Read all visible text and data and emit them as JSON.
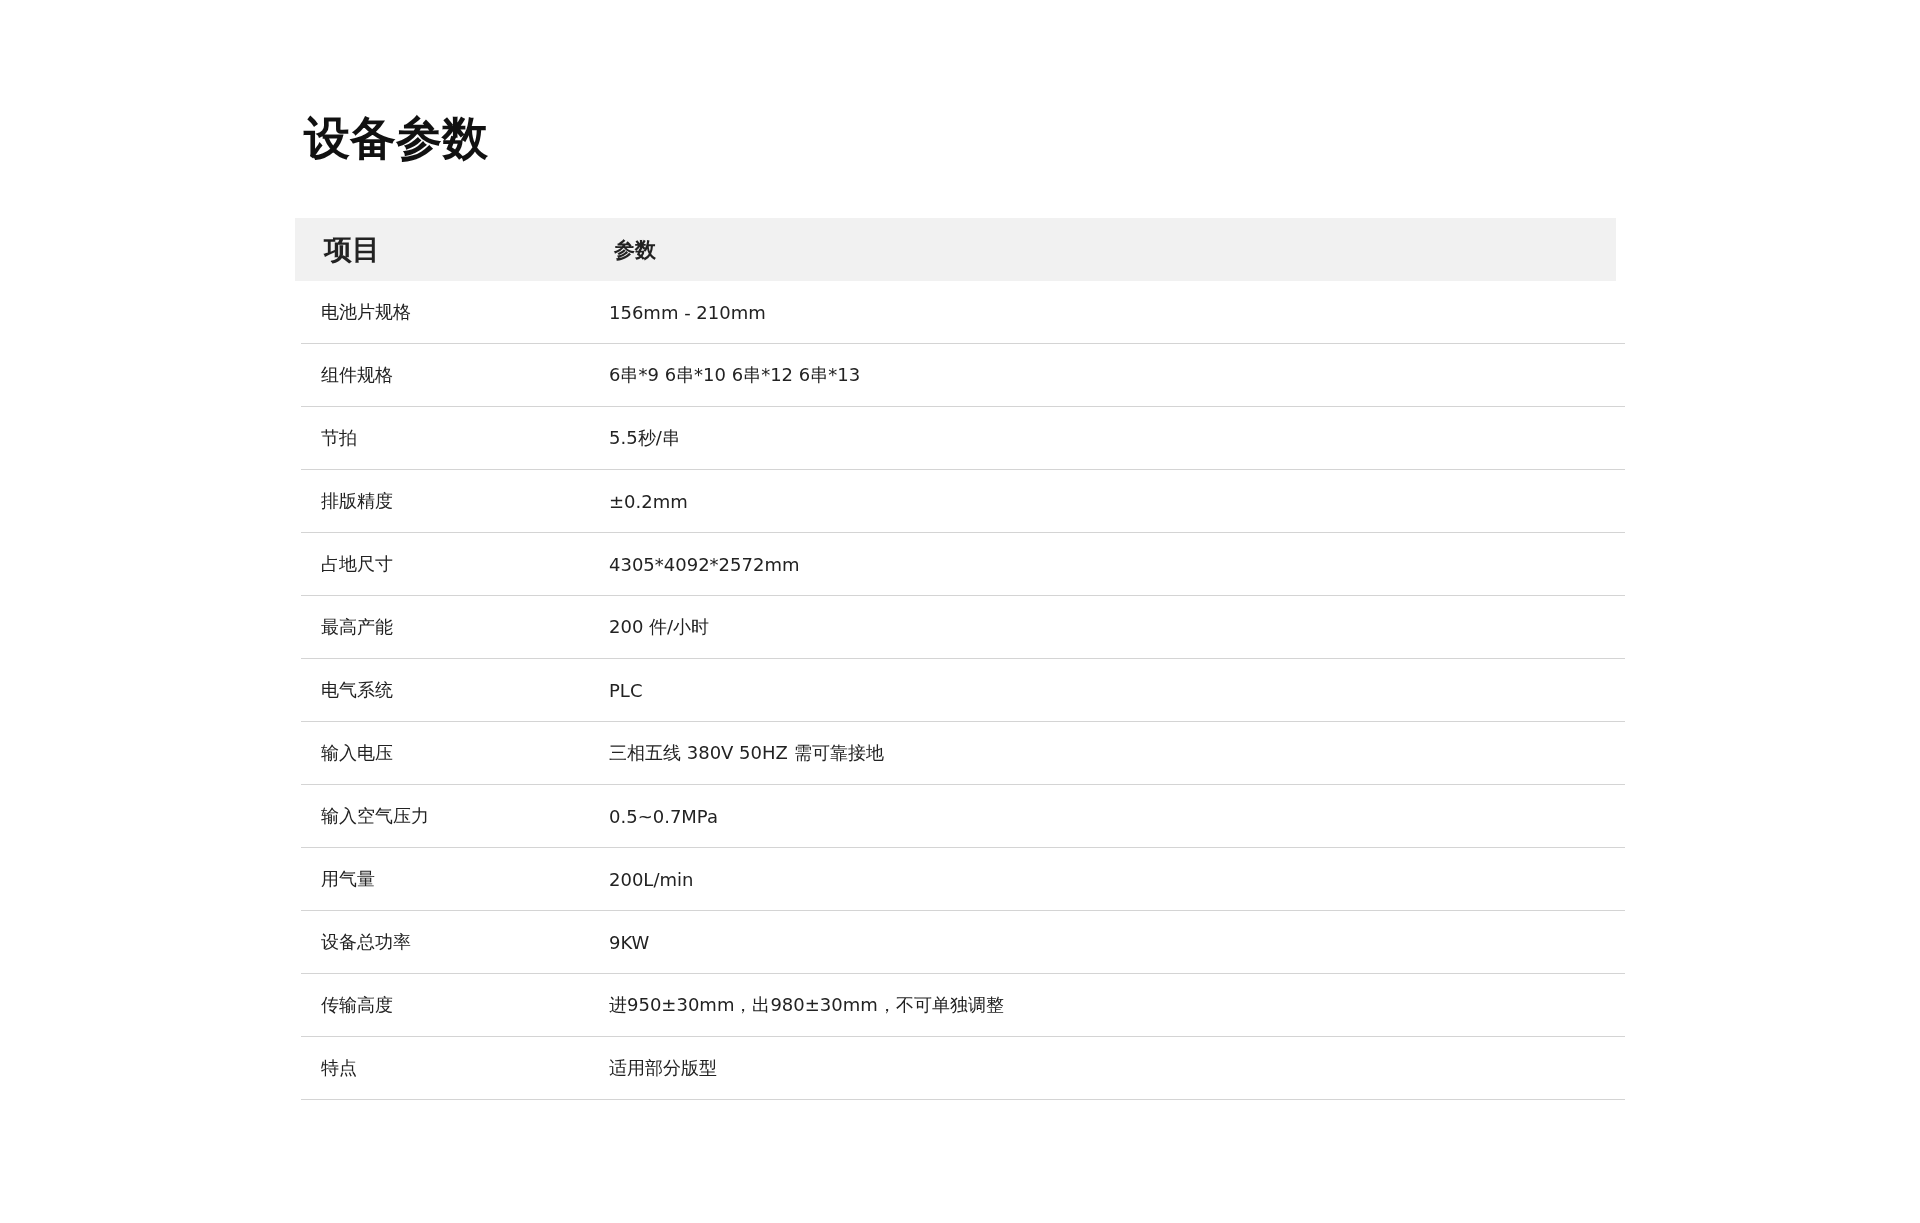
{
  "title": "设备参数",
  "table": {
    "columns": [
      "项目",
      "参数"
    ],
    "rows": [
      [
        "电池片规格",
        "156mm - 210mm"
      ],
      [
        "组件规格",
        "6串*9 6串*10 6串*12 6串*13"
      ],
      [
        "节拍",
        "5.5秒/串"
      ],
      [
        "排版精度",
        "±0.2mm"
      ],
      [
        "占地尺寸",
        "4305*4092*2572mm"
      ],
      [
        "最高产能",
        "200 件/小时"
      ],
      [
        "电气系统",
        "PLC"
      ],
      [
        "输入电压",
        "三相五线 380V 50HZ 需可靠接地"
      ],
      [
        "输入空气压力",
        "0.5~0.7MPa"
      ],
      [
        "用气量",
        "200L/min"
      ],
      [
        "设备总功率",
        "9KW"
      ],
      [
        "传输高度",
        "进950±30mm，出980±30mm，不可单独调整"
      ],
      [
        "特点",
        "适用部分版型"
      ]
    ]
  }
}
